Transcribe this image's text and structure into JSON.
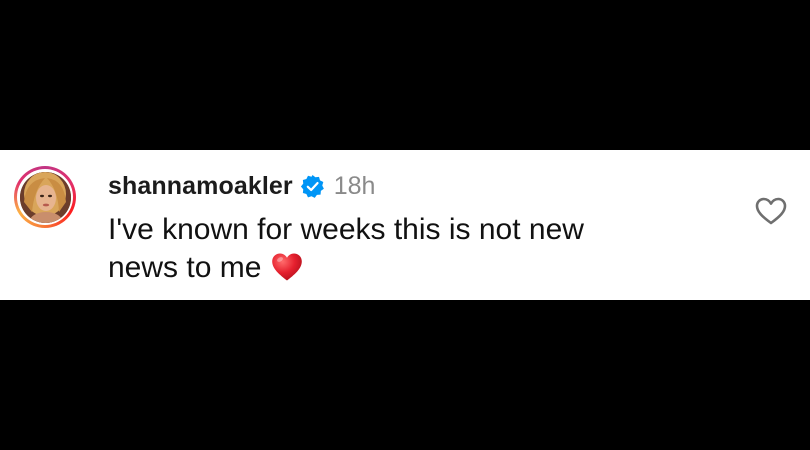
{
  "comment": {
    "username": "shannamoakler",
    "timestamp": "18h",
    "text_line1": "I've known for weeks this is not new",
    "text_line2": "news to me",
    "emoji": "red-heart"
  },
  "icons": {
    "verified": "verified-badge-icon",
    "like": "heart-outline-icon"
  },
  "colors": {
    "verified_blue": "#0095f6",
    "username_text": "#1c1c1c",
    "timestamp_text": "#8a8a8a",
    "emoji_red": "#e0202f",
    "background_band": "#ffffff",
    "letterbox": "#000000"
  }
}
